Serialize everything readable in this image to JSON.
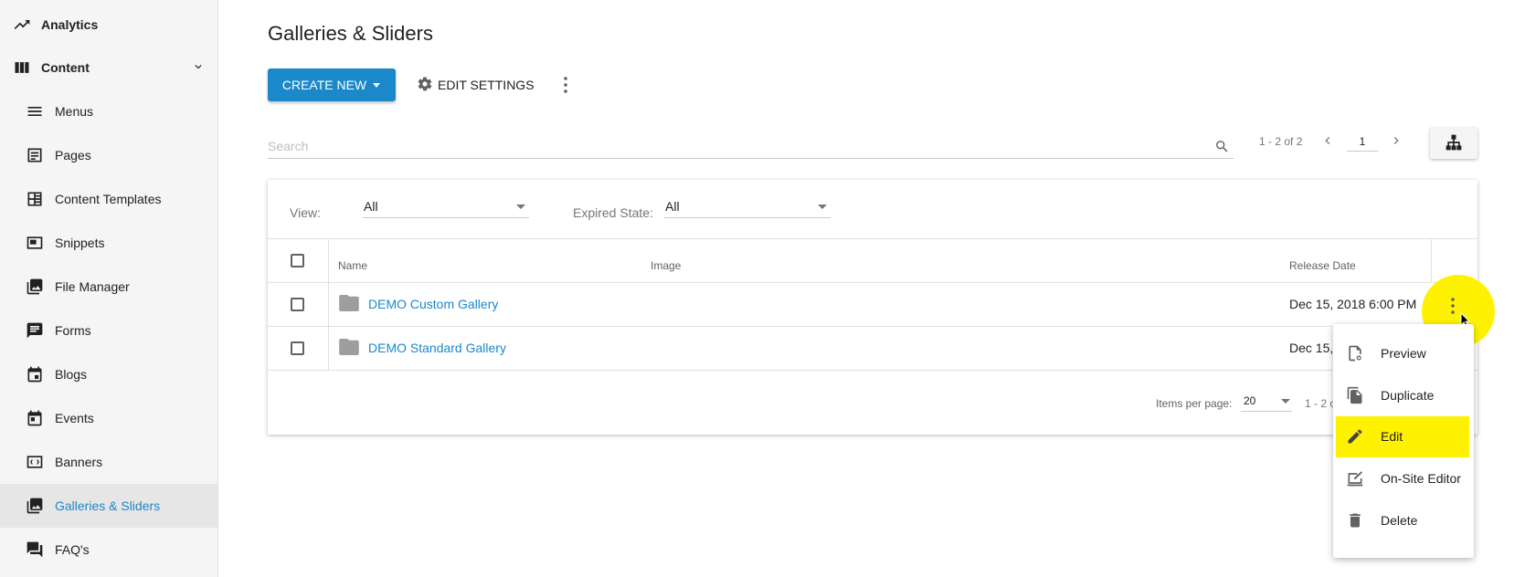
{
  "sidebar": {
    "items": [
      {
        "label": "Analytics",
        "icon": "trending-up-icon"
      },
      {
        "label": "Content",
        "icon": "view-column-icon"
      },
      {
        "label": "Menus",
        "icon": "menu-icon"
      },
      {
        "label": "Pages",
        "icon": "page-icon"
      },
      {
        "label": "Content Templates",
        "icon": "template-icon"
      },
      {
        "label": "Snippets",
        "icon": "snippet-icon"
      },
      {
        "label": "File Manager",
        "icon": "photo-library-icon"
      },
      {
        "label": "Forms",
        "icon": "form-icon"
      },
      {
        "label": "Blogs",
        "icon": "calendar-icon"
      },
      {
        "label": "Events",
        "icon": "event-icon"
      },
      {
        "label": "Banners",
        "icon": "code-icon"
      },
      {
        "label": "Galleries & Sliders",
        "icon": "collections-icon"
      },
      {
        "label": "FAQ's",
        "icon": "forum-icon"
      }
    ]
  },
  "header": {
    "title": "Galleries & Sliders",
    "create_label": "CREATE NEW",
    "settings_label": "EDIT SETTINGS"
  },
  "search": {
    "placeholder": "Search"
  },
  "pager": {
    "range": "1 - 2 of 2",
    "page": "1"
  },
  "filters": {
    "view_label": "View:",
    "view_value": "All",
    "expired_label": "Expired State:",
    "expired_value": "All"
  },
  "table": {
    "columns": [
      "Name",
      "Image",
      "Release Date"
    ],
    "rows": [
      {
        "name": "DEMO Custom Gallery",
        "release": "Dec 15, 2018 6:00 PM"
      },
      {
        "name": "DEMO Standard Gallery",
        "release": "Dec 15,"
      }
    ],
    "items_per_page_label": "Items per page:",
    "items_per_page": "20",
    "range_bottom": "1 - 2 o"
  },
  "row_menu": {
    "items": [
      {
        "label": "Preview",
        "icon": "preview-icon"
      },
      {
        "label": "Duplicate",
        "icon": "duplicate-icon"
      },
      {
        "label": "Edit",
        "icon": "edit-icon"
      },
      {
        "label": "On-Site Editor",
        "icon": "onsite-editor-icon"
      },
      {
        "label": "Delete",
        "icon": "delete-icon"
      }
    ]
  },
  "colors": {
    "accent": "#1a88c9",
    "highlight": "#fff200"
  }
}
